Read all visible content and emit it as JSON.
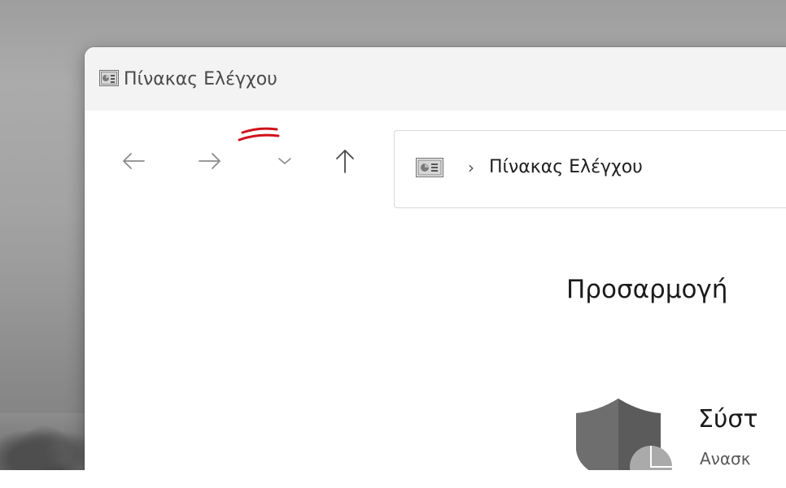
{
  "window": {
    "title": "Πίνακας Ελέγχου",
    "icon": "control-panel-icon"
  },
  "navigation": {
    "back_icon": "arrow-left-icon",
    "forward_icon": "arrow-right-icon",
    "recent_icon": "chevron-down-icon",
    "up_icon": "arrow-up-icon",
    "annotation_color": "#d0121b"
  },
  "address_bar": {
    "separator": "›",
    "breadcrumb": "Πίνακας Ελέγχου"
  },
  "content": {
    "heading": "Προσαρμογή",
    "categories": [
      {
        "title": "Σύστ",
        "subtitle": "Ανασκ",
        "icon": "security-shield-icon"
      }
    ]
  }
}
